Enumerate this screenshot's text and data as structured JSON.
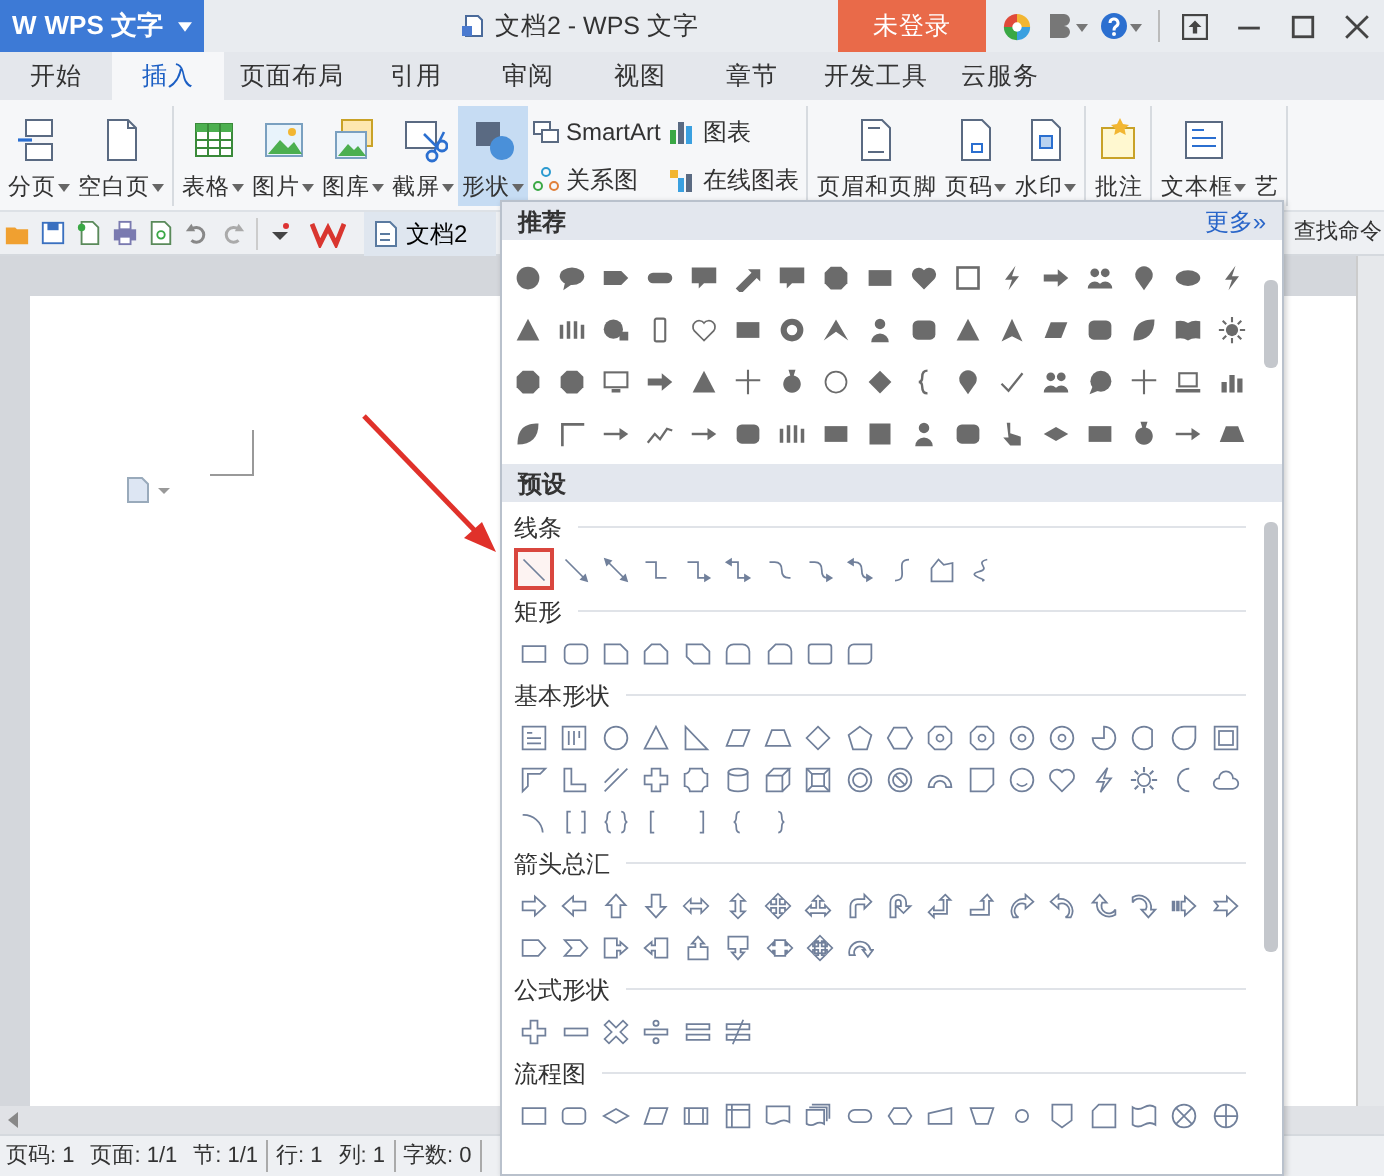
{
  "title_bar": {
    "app_logo": "W",
    "app_name": "WPS 文字",
    "title": "文档2 - WPS 文字",
    "login_button": "未登录"
  },
  "menu_tabs": [
    {
      "label": "开始",
      "selected": false
    },
    {
      "label": "插入",
      "selected": true
    },
    {
      "label": "页面布局",
      "selected": false
    },
    {
      "label": "引用",
      "selected": false
    },
    {
      "label": "审阅",
      "selected": false
    },
    {
      "label": "视图",
      "selected": false
    },
    {
      "label": "章节",
      "selected": false
    },
    {
      "label": "开发工具",
      "selected": false
    },
    {
      "label": "云服务",
      "selected": false
    }
  ],
  "ribbon": {
    "groups": [
      {
        "items": [
          {
            "kind": "large",
            "label": "分页",
            "dropdown": true,
            "selected": false
          },
          {
            "kind": "large",
            "label": "空白页",
            "dropdown": true,
            "selected": false
          }
        ]
      },
      {
        "items": [
          {
            "kind": "large",
            "label": "表格",
            "dropdown": true,
            "selected": false
          },
          {
            "kind": "large",
            "label": "图片",
            "dropdown": true,
            "selected": false
          },
          {
            "kind": "large",
            "label": "图库",
            "dropdown": true,
            "selected": false
          },
          {
            "kind": "large",
            "label": "截屏",
            "dropdown": true,
            "selected": false
          },
          {
            "kind": "large",
            "label": "形状",
            "dropdown": true,
            "selected": true
          },
          {
            "kind": "small",
            "label": "SmartArt",
            "dropdown": false,
            "selected": false
          },
          {
            "kind": "small",
            "label": "关系图",
            "dropdown": false,
            "selected": false
          },
          {
            "kind": "small",
            "label": "图表",
            "dropdown": false,
            "selected": false
          },
          {
            "kind": "small",
            "label": "在线图表",
            "dropdown": false,
            "selected": false
          }
        ]
      },
      {
        "items": [
          {
            "kind": "large",
            "label": "页眉和页脚",
            "dropdown": false,
            "selected": false
          },
          {
            "kind": "large",
            "label": "页码",
            "dropdown": true,
            "selected": false
          },
          {
            "kind": "large",
            "label": "水印",
            "dropdown": true,
            "selected": false
          }
        ]
      },
      {
        "items": [
          {
            "kind": "large",
            "label": "批注",
            "dropdown": false,
            "selected": false
          }
        ]
      },
      {
        "items": [
          {
            "kind": "large",
            "label": "文本框",
            "dropdown": true,
            "selected": false
          },
          {
            "kind": "large",
            "label": "艺",
            "dropdown": false,
            "selected": false
          }
        ]
      }
    ]
  },
  "quick_access": {
    "document_tab": "文档2",
    "command_search": "查找命令"
  },
  "shapes_panel": {
    "recommended": {
      "title": "推荐",
      "more_link": "更多»",
      "rows": [
        [
          {
            "kind": "circle"
          },
          {
            "kind": "oval-callout"
          },
          {
            "kind": "tag"
          },
          {
            "kind": "pill"
          },
          {
            "kind": "rect-callout"
          },
          {
            "kind": "arrow-up-right"
          },
          {
            "kind": "rect-callout"
          },
          {
            "kind": "octagon"
          },
          {
            "kind": "rect"
          },
          {
            "kind": "heart"
          },
          {
            "kind": "square-outline"
          },
          {
            "kind": "bolt"
          },
          {
            "kind": "arrow-right"
          },
          {
            "kind": "people"
          },
          {
            "kind": "pin"
          },
          {
            "kind": "ellipse"
          },
          {
            "kind": "bolt"
          }
        ],
        [
          {
            "kind": "triangle"
          },
          {
            "kind": "figures"
          },
          {
            "kind": "globe"
          },
          {
            "kind": "phone"
          },
          {
            "kind": "heart-outline"
          },
          {
            "kind": "rect"
          },
          {
            "kind": "ring"
          },
          {
            "kind": "chevron-up"
          },
          {
            "kind": "person"
          },
          {
            "kind": "rect-round"
          },
          {
            "kind": "triangle"
          },
          {
            "kind": "tent"
          },
          {
            "kind": "parallelogram"
          },
          {
            "kind": "rect-round"
          },
          {
            "kind": "leaf"
          },
          {
            "kind": "book"
          },
          {
            "kind": "sun"
          }
        ],
        [
          {
            "kind": "octagon"
          },
          {
            "kind": "octagon"
          },
          {
            "kind": "monitor"
          },
          {
            "kind": "arrow-right"
          },
          {
            "kind": "triangle"
          },
          {
            "kind": "plus-thin"
          },
          {
            "kind": "moneybag"
          },
          {
            "kind": "circle-outline"
          },
          {
            "kind": "diamond"
          },
          {
            "kind": "brace"
          },
          {
            "kind": "pin"
          },
          {
            "kind": "check"
          },
          {
            "kind": "people"
          },
          {
            "kind": "speech-circle"
          },
          {
            "kind": "plus-thin"
          },
          {
            "kind": "laptop"
          },
          {
            "kind": "chart"
          }
        ],
        [
          {
            "kind": "leaf"
          },
          {
            "kind": "corner"
          },
          {
            "kind": "arrow-line"
          },
          {
            "kind": "zigzag"
          },
          {
            "kind": "arrow-line"
          },
          {
            "kind": "rect-round"
          },
          {
            "kind": "figures"
          },
          {
            "kind": "rect"
          },
          {
            "kind": "square"
          },
          {
            "kind": "person"
          },
          {
            "kind": "rect-round"
          },
          {
            "kind": "hand"
          },
          {
            "kind": "diamond-flat"
          },
          {
            "kind": "rect"
          },
          {
            "kind": "moneybag"
          },
          {
            "kind": "arrow-line"
          },
          {
            "kind": "trapezoid"
          }
        ]
      ]
    },
    "presets": {
      "title": "预设",
      "sections": [
        {
          "title": "线条",
          "rows": [
            [
              {
                "kind": "line",
                "selected": true
              },
              {
                "kind": "line-arrow",
                "selected": false
              },
              {
                "kind": "line-double-arrow",
                "selected": false
              },
              {
                "kind": "elbow",
                "selected": false
              },
              {
                "kind": "elbow-arrow",
                "selected": false
              },
              {
                "kind": "elbow-double-arrow",
                "selected": false
              },
              {
                "kind": "curve",
                "selected": false
              },
              {
                "kind": "curve-arrow",
                "selected": false
              },
              {
                "kind": "curve-double-arrow",
                "selected": false
              },
              {
                "kind": "s-curve",
                "selected": false
              },
              {
                "kind": "freeform",
                "selected": false
              },
              {
                "kind": "scribble",
                "selected": false
              }
            ]
          ]
        },
        {
          "title": "矩形",
          "rows": [
            [
              {
                "kind": "rect"
              },
              {
                "kind": "rect-round"
              },
              {
                "kind": "rect-snip"
              },
              {
                "kind": "rect-snip-two"
              },
              {
                "kind": "rect-snip-diagonal"
              },
              {
                "kind": "rect-round-top"
              },
              {
                "kind": "rect-round-snip"
              },
              {
                "kind": "rect-round-two"
              },
              {
                "kind": "rect-round-diagonal"
              }
            ]
          ]
        },
        {
          "title": "基本形状",
          "rows": [
            [
              {
                "kind": "text-box"
              },
              {
                "kind": "vertical-text-box"
              },
              {
                "kind": "circle"
              },
              {
                "kind": "triangle"
              },
              {
                "kind": "right-triangle"
              },
              {
                "kind": "parallelogram"
              },
              {
                "kind": "trapezoid"
              },
              {
                "kind": "diamond"
              },
              {
                "kind": "pentagon"
              },
              {
                "kind": "hexagon"
              },
              {
                "kind": "heptagon"
              },
              {
                "kind": "octagon-numbered"
              },
              {
                "kind": "decagon"
              },
              {
                "kind": "dodecagon"
              },
              {
                "kind": "pie"
              },
              {
                "kind": "chord"
              },
              {
                "kind": "teardrop"
              },
              {
                "kind": "frame"
              }
            ],
            [
              {
                "kind": "half-frame"
              },
              {
                "kind": "l-shape"
              },
              {
                "kind": "diagonal-stripe"
              },
              {
                "kind": "cross"
              },
              {
                "kind": "plaque"
              },
              {
                "kind": "can"
              },
              {
                "kind": "cube"
              },
              {
                "kind": "bevel"
              },
              {
                "kind": "donut"
              },
              {
                "kind": "no-symbol"
              },
              {
                "kind": "block-arc"
              },
              {
                "kind": "folded-corner"
              },
              {
                "kind": "smiley"
              },
              {
                "kind": "heart"
              },
              {
                "kind": "lightning"
              },
              {
                "kind": "sun"
              },
              {
                "kind": "moon"
              },
              {
                "kind": "cloud"
              }
            ],
            [
              {
                "kind": "arc"
              },
              {
                "kind": "bracket-pair"
              },
              {
                "kind": "brace-pair"
              },
              {
                "kind": "left-bracket"
              },
              {
                "kind": "right-bracket"
              },
              {
                "kind": "left-brace"
              },
              {
                "kind": "right-brace"
              }
            ]
          ]
        },
        {
          "title": "箭头总汇",
          "rows": [
            [
              {
                "kind": "right-arrow"
              },
              {
                "kind": "left-arrow"
              },
              {
                "kind": "up-arrow"
              },
              {
                "kind": "down-arrow"
              },
              {
                "kind": "left-right-arrow"
              },
              {
                "kind": "up-down-arrow"
              },
              {
                "kind": "quad-arrow"
              },
              {
                "kind": "left-right-up-arrow"
              },
              {
                "kind": "bent-arrow"
              },
              {
                "kind": "u-turn-arrow"
              },
              {
                "kind": "left-up-arrow"
              },
              {
                "kind": "bent-up-arrow"
              },
              {
                "kind": "curved-right-arrow"
              },
              {
                "kind": "curved-left-arrow"
              },
              {
                "kind": "curved-up-arrow"
              },
              {
                "kind": "curved-down-arrow"
              },
              {
                "kind": "striped-right-arrow"
              },
              {
                "kind": "notched-right-arrow"
              }
            ],
            [
              {
                "kind": "pentagon-arrow"
              },
              {
                "kind": "chevron"
              },
              {
                "kind": "right-callout"
              },
              {
                "kind": "left-callout"
              },
              {
                "kind": "up-callout"
              },
              {
                "kind": "down-callout"
              },
              {
                "kind": "left-right-callout"
              },
              {
                "kind": "quad-callout"
              },
              {
                "kind": "circular-arrow"
              }
            ]
          ]
        },
        {
          "title": "公式形状",
          "rows": [
            [
              {
                "kind": "plus-sign"
              },
              {
                "kind": "minus-sign"
              },
              {
                "kind": "multiply-sign"
              },
              {
                "kind": "divide-sign"
              },
              {
                "kind": "equal-sign"
              },
              {
                "kind": "not-equal-sign"
              }
            ]
          ]
        },
        {
          "title": "流程图",
          "rows": [
            [
              {
                "kind": "process"
              },
              {
                "kind": "alternate-process"
              },
              {
                "kind": "decision"
              },
              {
                "kind": "data"
              },
              {
                "kind": "predefined-process"
              },
              {
                "kind": "internal-storage"
              },
              {
                "kind": "document"
              },
              {
                "kind": "multidocument"
              },
              {
                "kind": "terminator"
              },
              {
                "kind": "preparation"
              },
              {
                "kind": "manual-input"
              },
              {
                "kind": "manual-operation"
              },
              {
                "kind": "connector"
              },
              {
                "kind": "off-page-connector"
              },
              {
                "kind": "card"
              },
              {
                "kind": "punched-tape"
              },
              {
                "kind": "summing-junction"
              },
              {
                "kind": "or"
              }
            ]
          ]
        }
      ]
    }
  },
  "status_bar": [
    {
      "text": "页码: 1",
      "divider": false
    },
    {
      "text": "页面: 1/1",
      "divider": false
    },
    {
      "text": "节: 1/1",
      "divider": true
    },
    {
      "text": "行: 1",
      "divider": false
    },
    {
      "text": "列: 1",
      "divider": true
    },
    {
      "text": "字数: 0",
      "divider": true
    }
  ]
}
